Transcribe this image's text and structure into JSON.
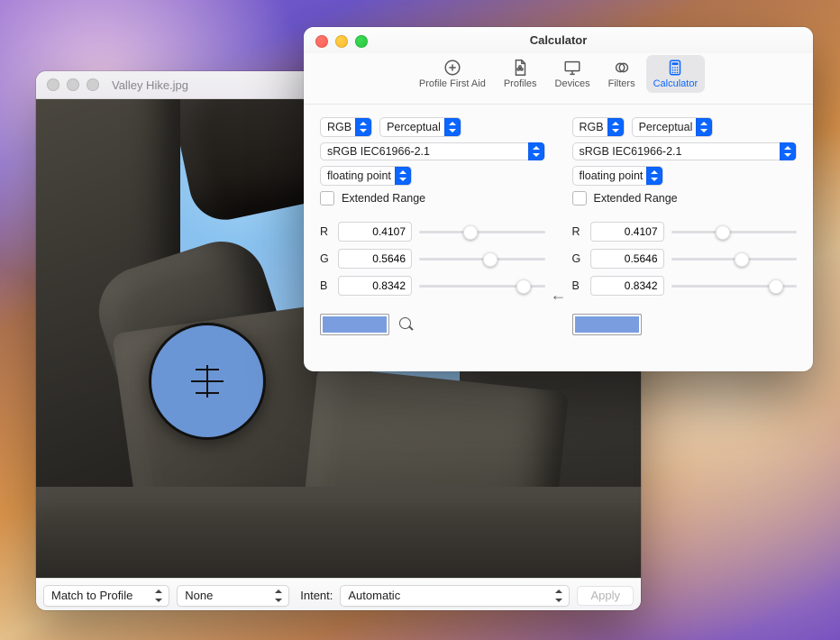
{
  "colors": {
    "sampled": "#799ddf",
    "accent": "#0a66ff"
  },
  "image_window": {
    "title": "Valley Hike.jpg",
    "footer": {
      "mode": "Match to Profile",
      "profile": "None",
      "intent_label": "Intent:",
      "intent_value": "Automatic",
      "apply": "Apply"
    }
  },
  "calc_window": {
    "title": "Calculator",
    "toolbar": [
      {
        "id": "profile-first-aid",
        "label": "Profile First Aid",
        "icon": "plus-circle"
      },
      {
        "id": "profiles",
        "label": "Profiles",
        "icon": "profile-doc"
      },
      {
        "id": "devices",
        "label": "Devices",
        "icon": "monitor"
      },
      {
        "id": "filters",
        "label": "Filters",
        "icon": "overlap"
      },
      {
        "id": "calculator",
        "label": "Calculator",
        "icon": "calculator"
      }
    ],
    "toolbar_selected": "calculator",
    "arrow_dir": "left",
    "left": {
      "color_model": "RGB",
      "render_intent": "Perceptual",
      "profile": "sRGB IEC61966-2.1",
      "number_format": "floating point",
      "extended_label": "Extended Range",
      "extended_checked": false,
      "channels": [
        {
          "name": "R",
          "value": "0.4107",
          "pct": 41.07
        },
        {
          "name": "G",
          "value": "0.5646",
          "pct": 56.46
        },
        {
          "name": "B",
          "value": "0.8342",
          "pct": 83.42
        }
      ]
    },
    "right": {
      "color_model": "RGB",
      "render_intent": "Perceptual",
      "profile": "sRGB IEC61966-2.1",
      "number_format": "floating point",
      "extended_label": "Extended Range",
      "extended_checked": false,
      "channels": [
        {
          "name": "R",
          "value": "0.4107",
          "pct": 41.07
        },
        {
          "name": "G",
          "value": "0.5646",
          "pct": 56.46
        },
        {
          "name": "B",
          "value": "0.8342",
          "pct": 83.42
        }
      ]
    }
  }
}
